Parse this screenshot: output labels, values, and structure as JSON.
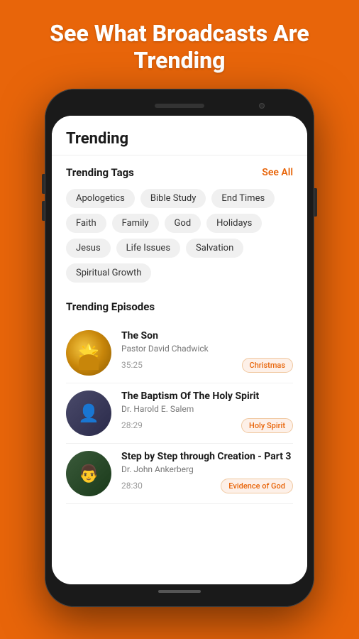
{
  "header": {
    "title": "See What Broadcasts Are Trending"
  },
  "phone": {
    "trending_title": "Trending",
    "trending_tags_section": {
      "title": "Trending Tags",
      "see_all_label": "See All",
      "tags": [
        "Apologetics",
        "Bible Study",
        "End Times",
        "Faith",
        "Family",
        "God",
        "Holidays",
        "Jesus",
        "Life Issues",
        "Salvation",
        "Spiritual Growth"
      ]
    },
    "trending_episodes_section": {
      "title": "Trending Episodes",
      "episodes": [
        {
          "title": "The Son",
          "speaker": "Pastor David Chadwick",
          "duration": "35:25",
          "tag": "Christmas",
          "thumb_type": "son"
        },
        {
          "title": "The Baptism Of The Holy Spirit",
          "speaker": "Dr. Harold E. Salem",
          "duration": "28:29",
          "tag": "Holy Spirit",
          "thumb_type": "baptism"
        },
        {
          "title": "Step by Step through Creation - Part 3",
          "speaker": "Dr. John Ankerberg",
          "duration": "28:30",
          "tag": "Evidence of God",
          "thumb_type": "creation"
        }
      ]
    }
  },
  "colors": {
    "accent": "#E8650A",
    "background": "#E8650A"
  }
}
